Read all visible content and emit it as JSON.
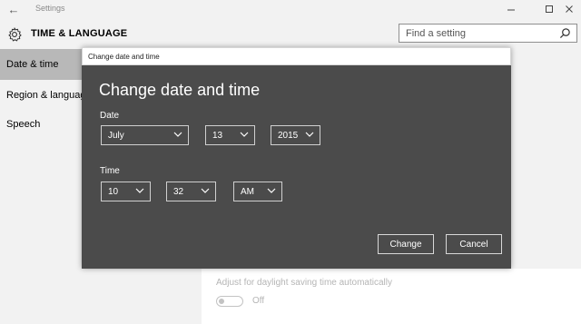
{
  "app": {
    "title": "Settings",
    "back_icon": "arrow-left-icon",
    "window_controls": [
      "minimize-icon",
      "maximize-icon",
      "close-icon"
    ]
  },
  "header": {
    "icon": "gear-icon",
    "title": "TIME & LANGUAGE",
    "search_placeholder": "Find a setting",
    "search_icon": "search-icon"
  },
  "sidebar": {
    "items": [
      {
        "label": "Date & time",
        "selected": true
      },
      {
        "label": "Region & language",
        "selected": false
      },
      {
        "label": "Speech",
        "selected": false
      }
    ],
    "selected_color": "#b8b8b8"
  },
  "content": {
    "dst_label": "Adjust for daylight saving time automatically",
    "dst_toggle": "Off"
  },
  "dialog": {
    "window_title": "Change date and time",
    "heading": "Change date and time",
    "background": "#4b4b4b",
    "date_label": "Date",
    "month": "July",
    "day": "13",
    "year": "2015",
    "time_label": "Time",
    "hour": "10",
    "minute": "32",
    "ampm": "AM",
    "change_label": "Change",
    "cancel_label": "Cancel",
    "dropdown_icon": "chevron-down-icon"
  }
}
